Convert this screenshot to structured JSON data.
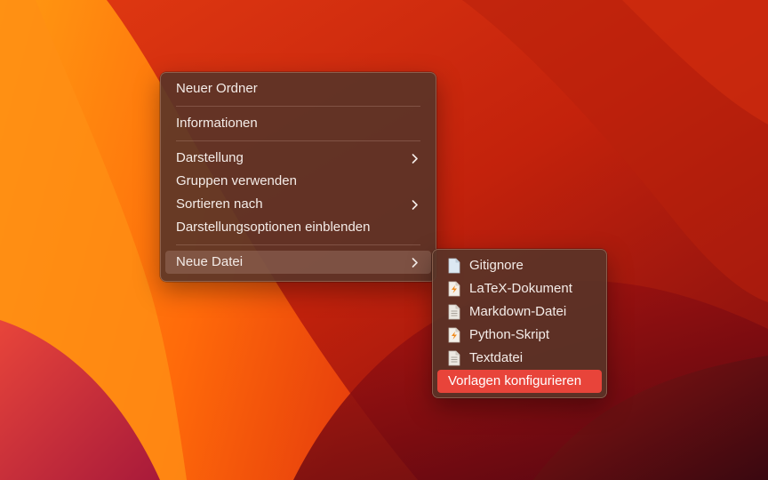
{
  "context_menu": {
    "items": [
      {
        "label": "Neuer Ordner"
      },
      {
        "label": "Informationen"
      },
      {
        "label": "Darstellung"
      },
      {
        "label": "Gruppen verwenden"
      },
      {
        "label": "Sortieren nach"
      },
      {
        "label": "Darstellungsoptionen einblenden"
      },
      {
        "label": "Neue Datei"
      }
    ]
  },
  "submenu": {
    "items": [
      {
        "label": "Gitignore",
        "icon": "blank-document-icon"
      },
      {
        "label": "LaTeX-Dokument",
        "icon": "latex-document-icon"
      },
      {
        "label": "Markdown-Datei",
        "icon": "text-document-icon"
      },
      {
        "label": "Python-Skript",
        "icon": "script-document-icon"
      },
      {
        "label": "Textdatei",
        "icon": "text-document-icon"
      },
      {
        "label": "Vorlagen konfigurieren"
      }
    ]
  },
  "colors": {
    "selection": "#e8443a",
    "menu_background": "#583428",
    "menu_text": "#f4ece8"
  }
}
